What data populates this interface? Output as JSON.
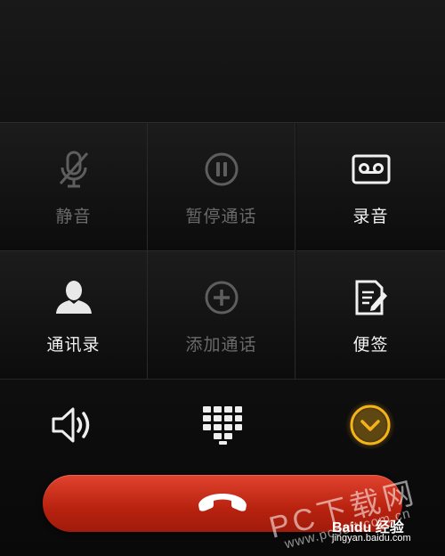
{
  "call_controls": {
    "mute": {
      "label": "静音",
      "icon": "muted-mic-icon",
      "enabled": false
    },
    "pause_call": {
      "label": "暂停通话",
      "icon": "pause-circle-icon",
      "enabled": false
    },
    "record": {
      "label": "录音",
      "icon": "cassette-tape-icon",
      "enabled": true
    },
    "contacts": {
      "label": "通讯录",
      "icon": "person-icon",
      "enabled": true
    },
    "add_call": {
      "label": "添加通话",
      "icon": "plus-circle-icon",
      "enabled": false
    },
    "notes": {
      "label": "便签",
      "icon": "note-pencil-icon",
      "enabled": true
    }
  },
  "bottom_bar": {
    "speaker": {
      "icon": "speaker-icon"
    },
    "dialpad": {
      "icon": "dialpad-icon"
    },
    "collapse": {
      "icon": "chevron-down-circle-icon",
      "accent": "#f5b31a"
    }
  },
  "end_call": {
    "icon": "hang-up-phone-icon",
    "color": "#c8301a"
  },
  "watermarks": {
    "site": "PC下载网",
    "site_url": "www.pcsoft.com.cn",
    "baidu_brand": "Baidu 经验",
    "baidu_url": "jingyan.baidu.com"
  }
}
